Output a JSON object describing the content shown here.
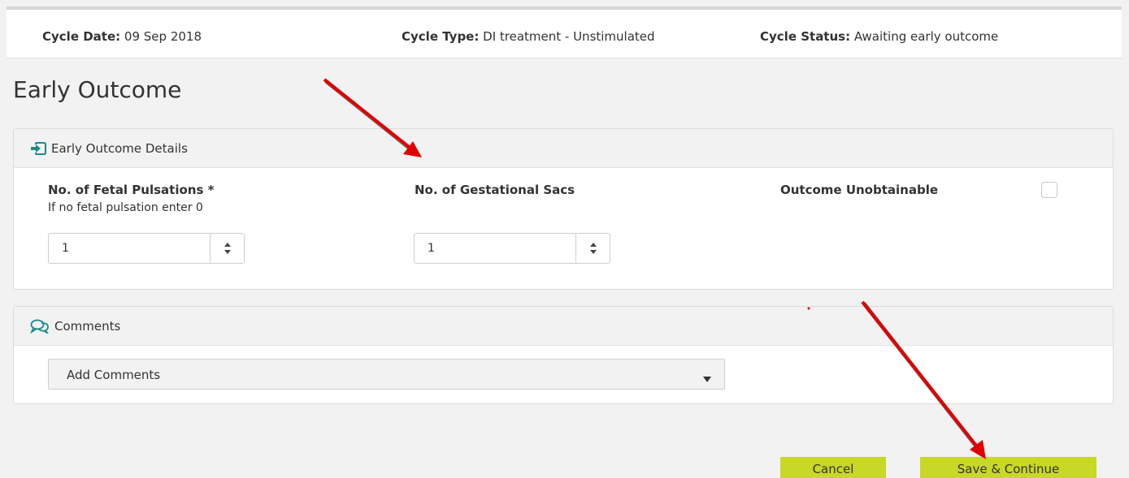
{
  "cycle": {
    "date_label": "Cycle Date:",
    "date_value": "09 Sep 2018",
    "type_label": "Cycle Type:",
    "type_value": "DI treatment - Unstimulated",
    "status_label": "Cycle Status:",
    "status_value": "Awaiting early outcome"
  },
  "page_title": "Early Outcome",
  "outcome_panel": {
    "title": "Early Outcome Details",
    "fetal_pulsations_label": "No. of Fetal Pulsations  *",
    "fetal_pulsations_hint": "If no fetal pulsation enter 0",
    "fetal_pulsations_value": "1",
    "gestational_sacs_label": "No. of Gestational Sacs",
    "gestational_sacs_value": "1",
    "unobtainable_label": "Outcome Unobtainable",
    "unobtainable_checked": false
  },
  "comments_panel": {
    "title": "Comments",
    "select_value": "Add Comments"
  },
  "buttons": {
    "cancel": "Cancel",
    "save": "Save & Continue",
    "accent_color": "#c8d826"
  },
  "colors": {
    "icon_teal": "#1a8a8a",
    "annotation_red": "#e00000"
  }
}
